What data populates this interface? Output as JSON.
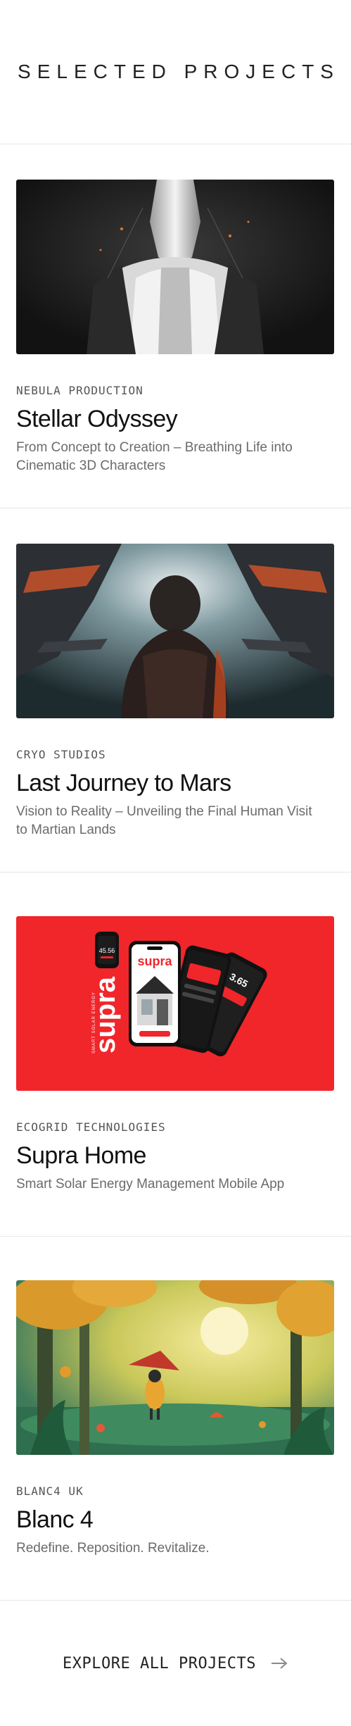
{
  "header": {
    "title": "SELECTED PROJECTS"
  },
  "projects": [
    {
      "client": "NEBULA PRODUCTION",
      "title": "Stellar Odyssey",
      "description": "From Concept to Creation – Breathing Life into Cinematic 3D Characters"
    },
    {
      "client": "CRYO STUDIOS",
      "title": "Last Journey to Mars",
      "description": "Vision to Reality – Unveiling the Final Human Visit to Martian Lands"
    },
    {
      "client": "ECOGRID TECHNOLOGIES",
      "title": "Supra Home",
      "description": "Smart Solar Energy Management Mobile App",
      "image_text": {
        "watch": "45.56",
        "phone_brand": "supra",
        "phone_value": "3.65",
        "vertical_brand": "supra",
        "vertical_tagline": "SMART SOLAR ENERGY"
      }
    },
    {
      "client": "BLANC4 UK",
      "title": "Blanc 4",
      "description": "Redefine. Reposition. Revitalize."
    }
  ],
  "footer": {
    "cta": "EXPLORE ALL PROJECTS",
    "icon": "arrow-right-icon"
  },
  "colors": {
    "supra_red": "#f0262b",
    "divider": "#e6e6e6",
    "muted_text": "#6b6b6b"
  }
}
